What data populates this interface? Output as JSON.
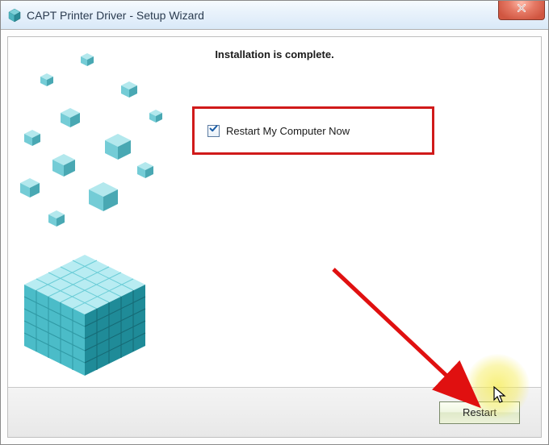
{
  "window": {
    "title": "CAPT Printer Driver - Setup Wizard"
  },
  "content": {
    "main_message": "Installation is complete.",
    "restart_checkbox_label": "Restart My Computer Now",
    "restart_checked": true
  },
  "buttons": {
    "action_label": "Restart"
  },
  "icons": {
    "app": "installer-cube-icon",
    "close": "close-icon",
    "check": "checkmark-icon"
  }
}
